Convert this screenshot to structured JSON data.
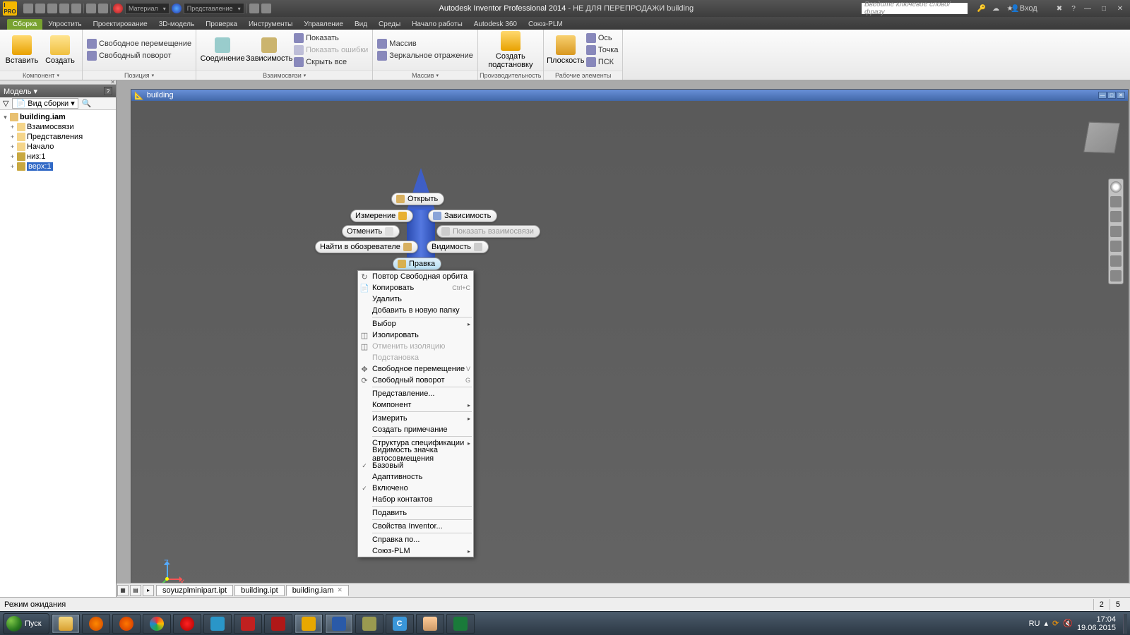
{
  "title": {
    "app": "Autodesk Inventor Professional 2014",
    "suffix": "- НЕ ДЛЯ ПЕРЕПРОДАЖИ   building",
    "qat_material": "Материал",
    "qat_view": "Представление",
    "search_placeholder": "Введите ключевое слово/фразу",
    "signin": "Вход"
  },
  "tabs": {
    "t0": "Сборка",
    "t1": "Упростить",
    "t2": "Проектирование",
    "t3": "3D-модель",
    "t4": "Проверка",
    "t5": "Инструменты",
    "t6": "Управление",
    "t7": "Вид",
    "t8": "Среды",
    "t9": "Начало работы",
    "t10": "Autodesk 360",
    "t11": "Союз-PLM"
  },
  "ribbon": {
    "insert": "Вставить",
    "create": "Создать",
    "g_component": "Компонент",
    "free_move": "Свободное перемещение",
    "free_rotate": "Свободный поворот",
    "g_position": "Позиция",
    "join": "Соединение",
    "constrain": "Зависимость",
    "show": "Показать",
    "show_err": "Показать ошибки",
    "hide_all": "Скрыть все",
    "g_rel": "Взаимосвязи",
    "array": "Массив",
    "mirror": "Зеркальное отражение",
    "g_array": "Массив",
    "placement": "Создать подстановку",
    "g_perf": "Производительность",
    "plane": "Плоскость",
    "axis": "Ось",
    "point": "Точка",
    "ucs": "ПСК",
    "g_work": "Рабочие элементы"
  },
  "panel": {
    "title": "Модель",
    "filter": "Вид сборки"
  },
  "tree": {
    "root": "building.iam",
    "n1": "Взаимосвязи",
    "n2": "Представления",
    "n3": "Начало",
    "n4": "низ:1",
    "n5": "верх:1"
  },
  "doc": {
    "title": "building"
  },
  "pills": {
    "open": "Открыть",
    "measure": "Измерение",
    "constrain": "Зависимость",
    "cancel": "Отменить",
    "showrel": "Показать взаимосвязи",
    "find": "Найти в обозревателе",
    "visibility": "Видимость",
    "edit": "Правка"
  },
  "ctx": {
    "repeat": "Повтор Свободная орбита",
    "copy": "Копировать",
    "copy_sc": "Ctrl+C",
    "delete": "Удалить",
    "addfolder": "Добавить в новую папку",
    "select": "Выбор",
    "isolate": "Изолировать",
    "uniso": "Отменить изоляцию",
    "subst": "Подстановка",
    "freemove": "Свободное перемещение",
    "freemove_sc": "V",
    "freerot": "Свободный поворот",
    "freerot_sc": "G",
    "repr": "Представление...",
    "component": "Компонент",
    "measure": "Измерить",
    "note": "Создать примечание",
    "bom": "Структура спецификации",
    "autovis": "Видимость значка автосовмещения",
    "base": "Базовый",
    "adapt": "Адаптивность",
    "enabled": "Включено",
    "contacts": "Набор контактов",
    "suppress": "Подавить",
    "iprops": "Свойства Inventor...",
    "help": "Справка по...",
    "soyuz": "Союз-PLM"
  },
  "doctabs": {
    "t1": "soyuzplminipart.ipt",
    "t2": "building.ipt",
    "t3": "building.iam"
  },
  "status": {
    "msg": "Режим ожидания",
    "c1": "2",
    "c2": "5"
  },
  "taskbar": {
    "start": "Пуск",
    "lang": "RU",
    "time": "17:04",
    "date": "19.06.2015"
  }
}
